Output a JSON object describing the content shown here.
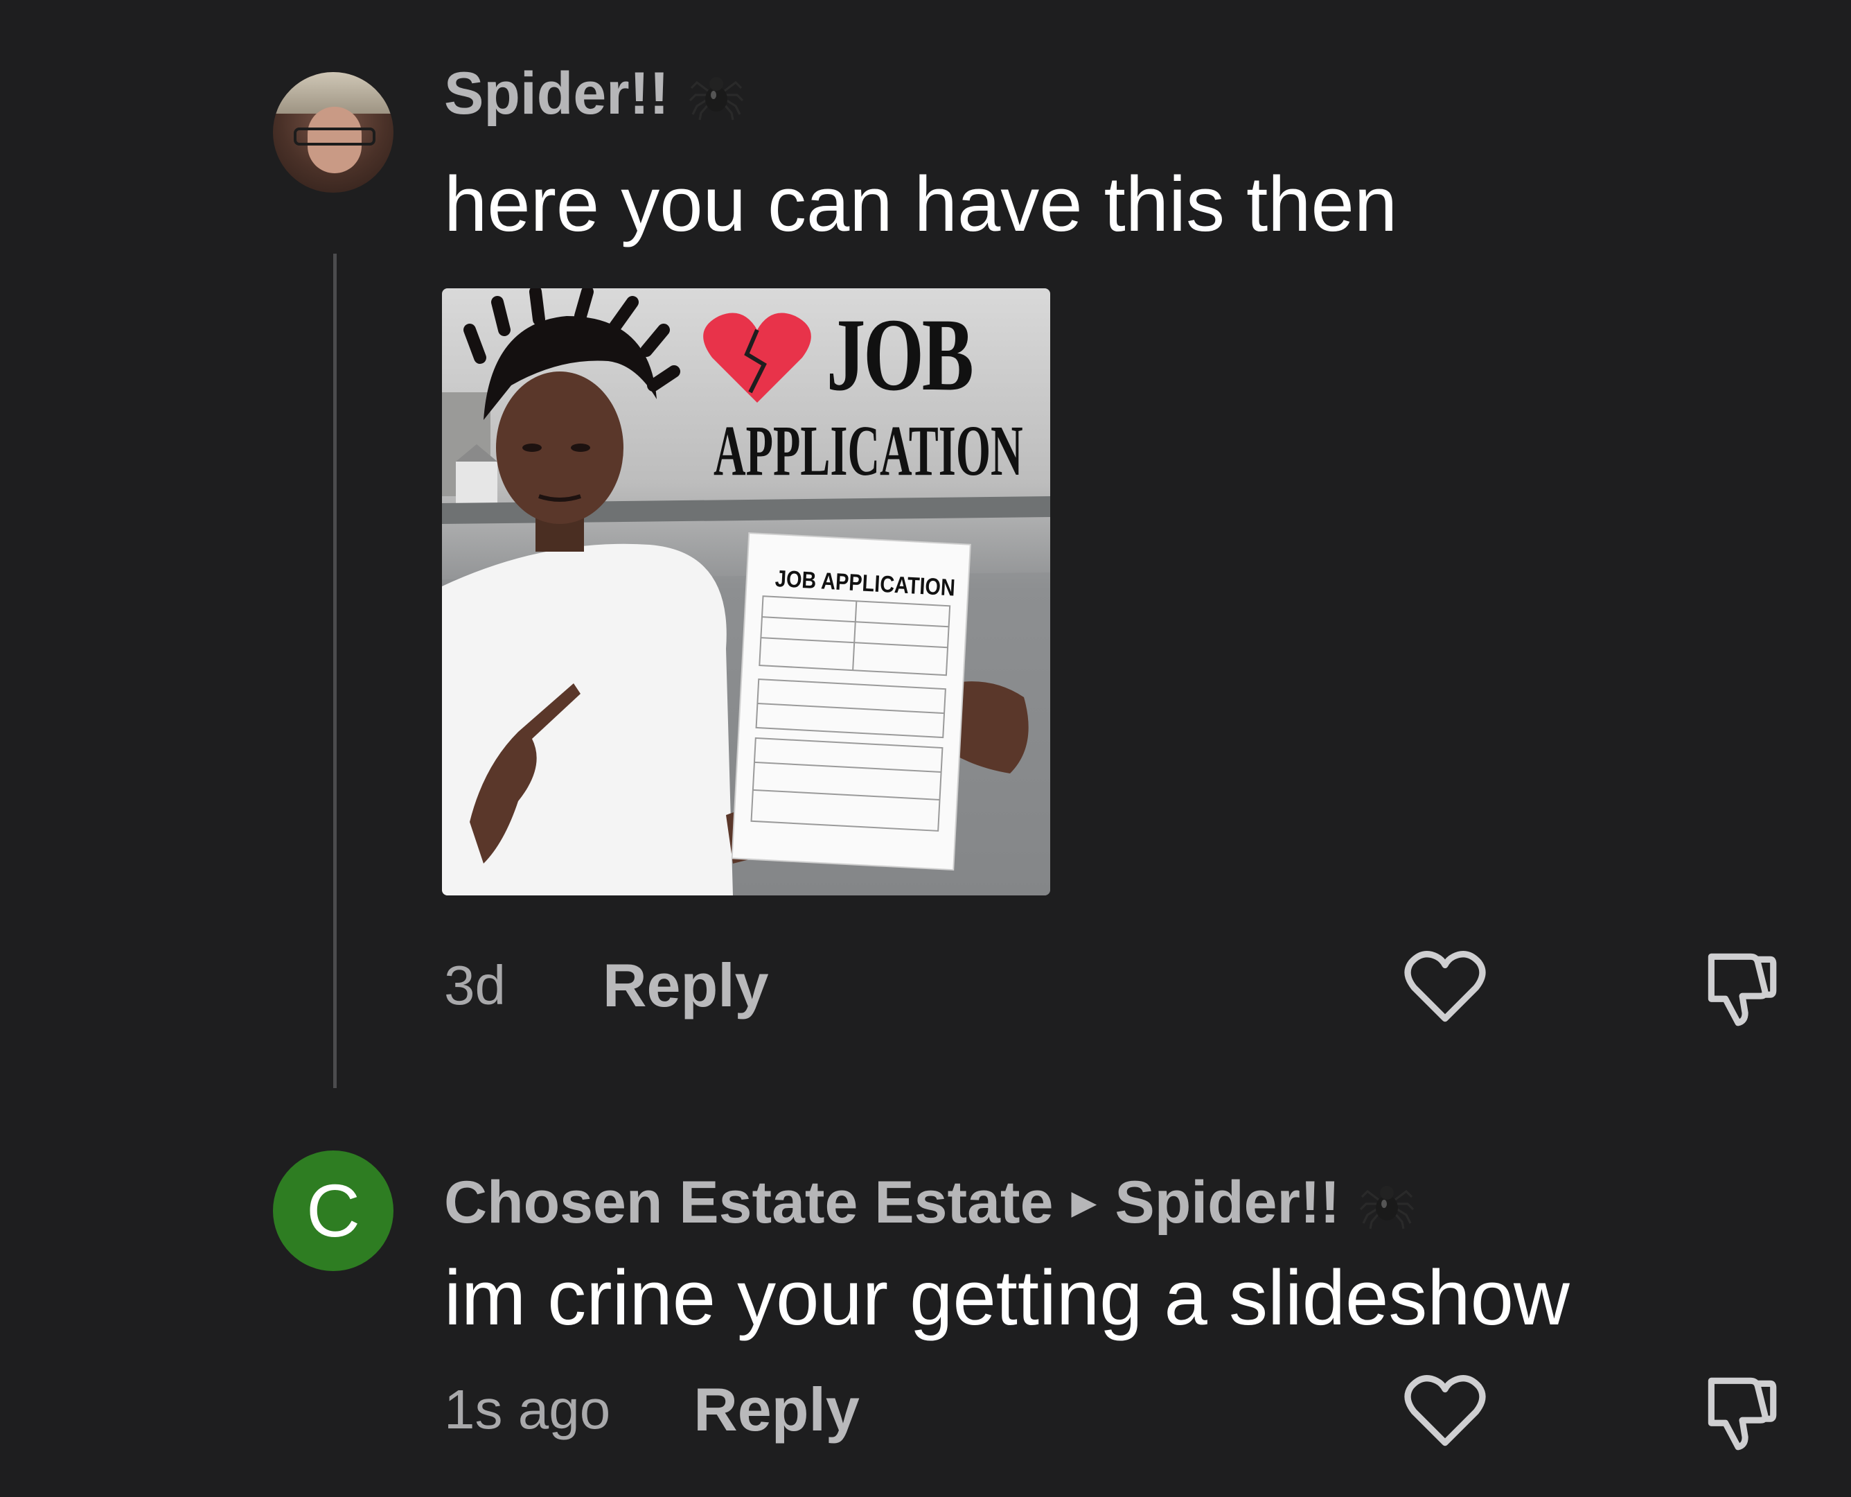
{
  "comments": [
    {
      "username": "Spider!!",
      "text": "here you can have this then",
      "attachment": {
        "headline_line1": "JOB",
        "headline_line2": "APPLICATION",
        "paper_title": "JOB APPLICATION"
      },
      "time": "3d",
      "reply_label": "Reply",
      "avatar_type": "photo"
    },
    {
      "username": "Chosen Estate Estate",
      "reply_to": "Spider!!",
      "avatar_letter": "C",
      "text": "im crine your getting a slideshow",
      "time": "1s ago",
      "reply_label": "Reply",
      "avatar_color": "#2e7d22"
    }
  ],
  "icons": {
    "spider": "spider-icon",
    "like": "heart-icon",
    "dislike": "thumbs-down-icon",
    "reply_arrow": "play-arrow-icon"
  },
  "colors": {
    "background": "#1e1e1f",
    "username": "#b6b6b8",
    "text": "#ffffff",
    "avatar_green": "#2e7d22"
  }
}
